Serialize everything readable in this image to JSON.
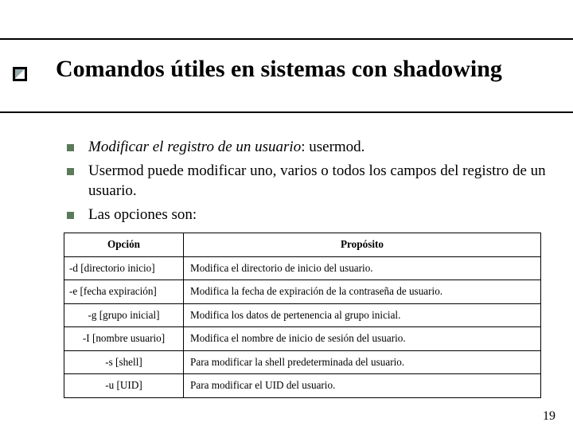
{
  "title": "Comandos útiles en sistemas con shadowing",
  "bullets": {
    "b0_before": "Modificar el registro de un usuario",
    "b0_after": ": usermod.",
    "b1": "Usermod puede modificar uno, varios o todos los campos del registro de un usuario.",
    "b2": "Las opciones son:"
  },
  "table": {
    "headers": {
      "opt": "Opción",
      "purpose": "Propósito"
    },
    "rows": [
      {
        "opt": "-d [directorio inicio]",
        "purpose": "Modifica el directorio de inicio del usuario.",
        "align": "left"
      },
      {
        "opt": "-e [fecha expiración]",
        "purpose": "Modifica la fecha de expiración de la contraseña de usuario.",
        "align": "left"
      },
      {
        "opt": "-g [grupo inicial]",
        "purpose": "Modifica los datos de pertenencia al grupo inicial.",
        "align": "center"
      },
      {
        "opt": "-I [nombre usuario]",
        "purpose": "Modifica el nombre de inicio de sesión del usuario.",
        "align": "center"
      },
      {
        "opt": "-s [shell]",
        "purpose": "Para modificar la shell predeterminada del usuario.",
        "align": "center"
      },
      {
        "opt": "-u [UID]",
        "purpose": "Para modificar el UID del usuario.",
        "align": "center"
      }
    ]
  },
  "page_number": "19"
}
